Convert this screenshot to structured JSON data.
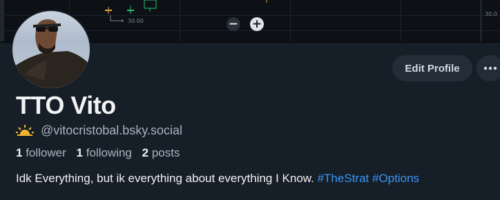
{
  "banner": {
    "price_marker": "30.00",
    "axis_label_top": "30.0",
    "axis_label_bottom": "",
    "zoom_out_symbol": "−",
    "zoom_in_symbol": "+"
  },
  "profile": {
    "display_name": "TTO Vito",
    "handle": "@vitocristobal.bsky.social",
    "edit_button_label": "Edit Profile",
    "followers_count": "1",
    "followers_label": "follower",
    "following_count": "1",
    "following_label": "following",
    "posts_count": "2",
    "posts_label": "posts",
    "bio_text": "Idk Everything, but ik everything about everything I Know.",
    "hashtags": [
      "#TheStrat",
      "#Options"
    ]
  },
  "colors": {
    "background": "#161e27",
    "hashtag": "#3b94f5",
    "button_bg": "#232c37",
    "sun_icon": "#f4b62e"
  },
  "icons": {
    "handle_icon": "sunrise-icon",
    "more_icon": "ellipsis-icon"
  }
}
